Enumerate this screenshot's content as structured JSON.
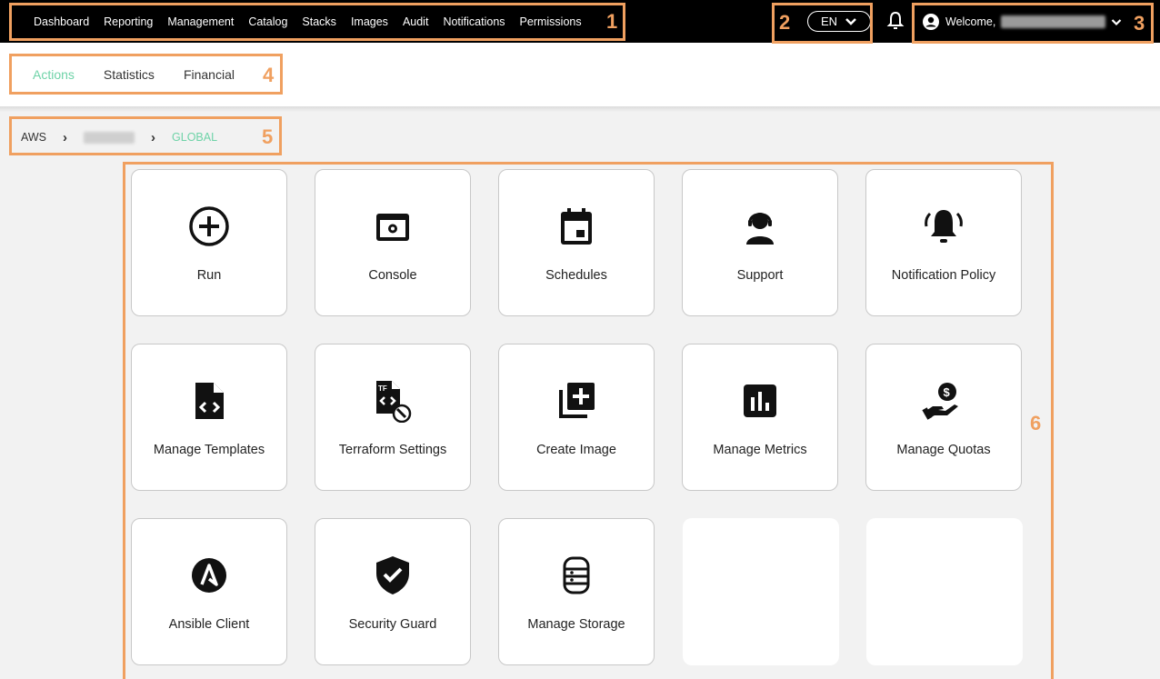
{
  "nav": {
    "items": [
      "Dashboard",
      "Reporting",
      "Management",
      "Catalog",
      "Stacks",
      "Images",
      "Audit",
      "Notifications",
      "Permissions"
    ]
  },
  "language": {
    "value": "EN"
  },
  "user": {
    "welcome": "Welcome,"
  },
  "tabs": [
    {
      "label": "Actions",
      "active": true
    },
    {
      "label": "Statistics"
    },
    {
      "label": "Financial"
    }
  ],
  "breadcrumb": {
    "root": "AWS",
    "current": "GLOBAL"
  },
  "annotations": [
    "1",
    "2",
    "3",
    "4",
    "5",
    "6"
  ],
  "tiles": [
    {
      "label": "Run",
      "icon": "plus-circle-icon"
    },
    {
      "label": "Console",
      "icon": "console-icon"
    },
    {
      "label": "Schedules",
      "icon": "calendar-icon"
    },
    {
      "label": "Support",
      "icon": "support-agent-icon"
    },
    {
      "label": "Notification Policy",
      "icon": "bell-ring-icon"
    },
    {
      "label": "Manage Templates",
      "icon": "code-file-icon"
    },
    {
      "label": "Terraform Settings",
      "icon": "terraform-file-icon"
    },
    {
      "label": "Create Image",
      "icon": "add-library-icon"
    },
    {
      "label": "Manage Metrics",
      "icon": "bar-chart-icon"
    },
    {
      "label": "Manage Quotas",
      "icon": "money-hand-icon"
    },
    {
      "label": "Ansible Client",
      "icon": "ansible-icon"
    },
    {
      "label": "Security Guard",
      "icon": "shield-check-icon"
    },
    {
      "label": "Manage Storage",
      "icon": "database-icon"
    }
  ],
  "colors": {
    "accent": "#6fd3a8",
    "annotation": "#f0a060",
    "topbar": "#000000"
  }
}
